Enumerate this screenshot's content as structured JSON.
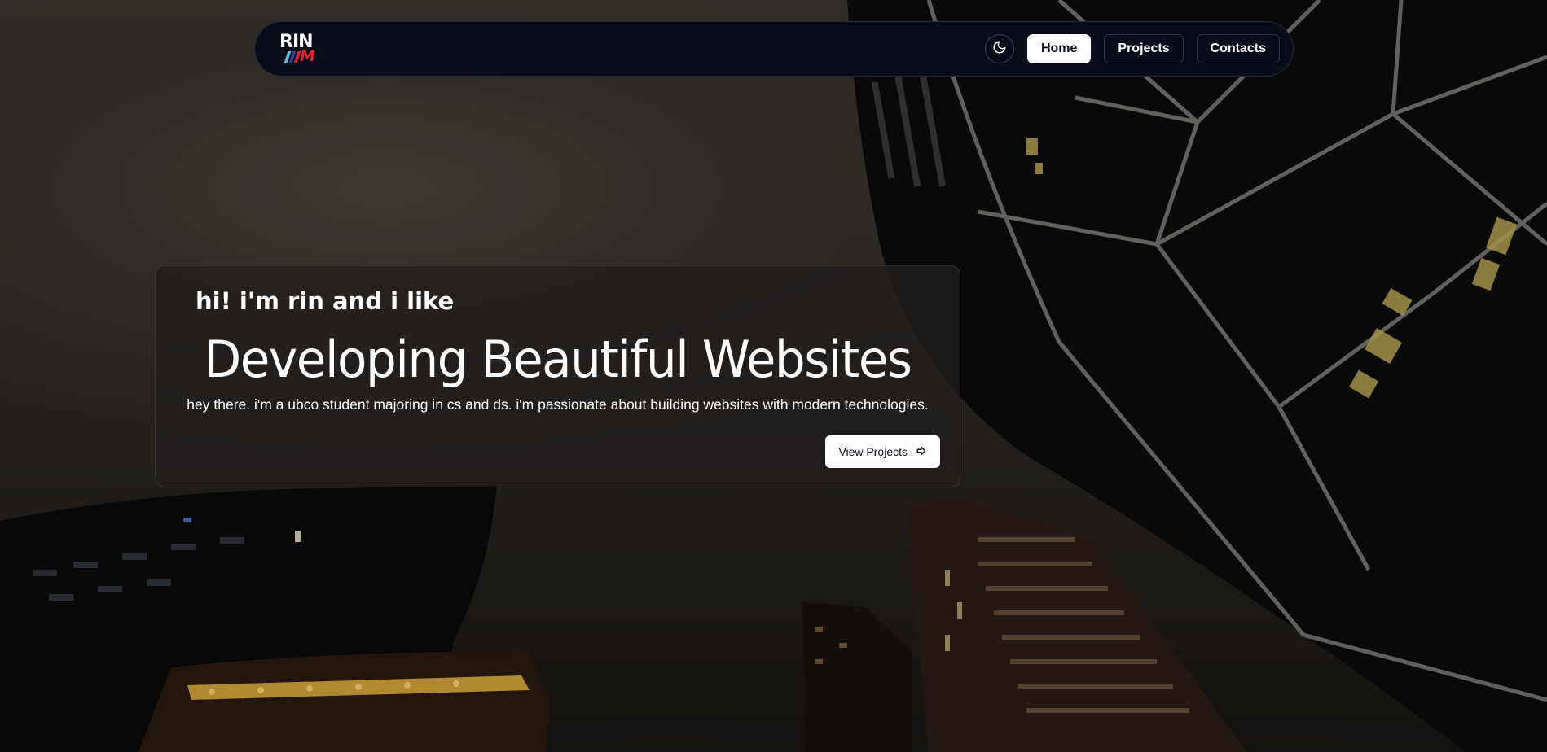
{
  "colors": {
    "nav_background": "#0a0d18",
    "card_background": "#201e1c",
    "text": "#ffffff",
    "accent_red": "#e0212b",
    "stripe_light_blue": "#5fb8e6",
    "stripe_dark_blue": "#2d3f8f",
    "stripe_red": "#e0212b"
  },
  "navbar": {
    "logo": {
      "top_text": "RIN",
      "bottom_text": "M"
    },
    "theme_toggle_icon": "moon-icon",
    "links": [
      {
        "label": "Home",
        "active": true
      },
      {
        "label": "Projects",
        "active": false
      },
      {
        "label": "Contacts",
        "active": false
      }
    ]
  },
  "hero": {
    "intro": "hi! i'm rin and i like",
    "title": "Developing Beautiful Websites",
    "description": "hey there. i'm a ubco student majoring in cs and ds. i'm passionate about building websites with modern technologies.",
    "cta": {
      "label": "View Projects",
      "icon": "arrow-right-icon"
    }
  },
  "background": {
    "icon": "night-city-skyscrapers-image"
  }
}
